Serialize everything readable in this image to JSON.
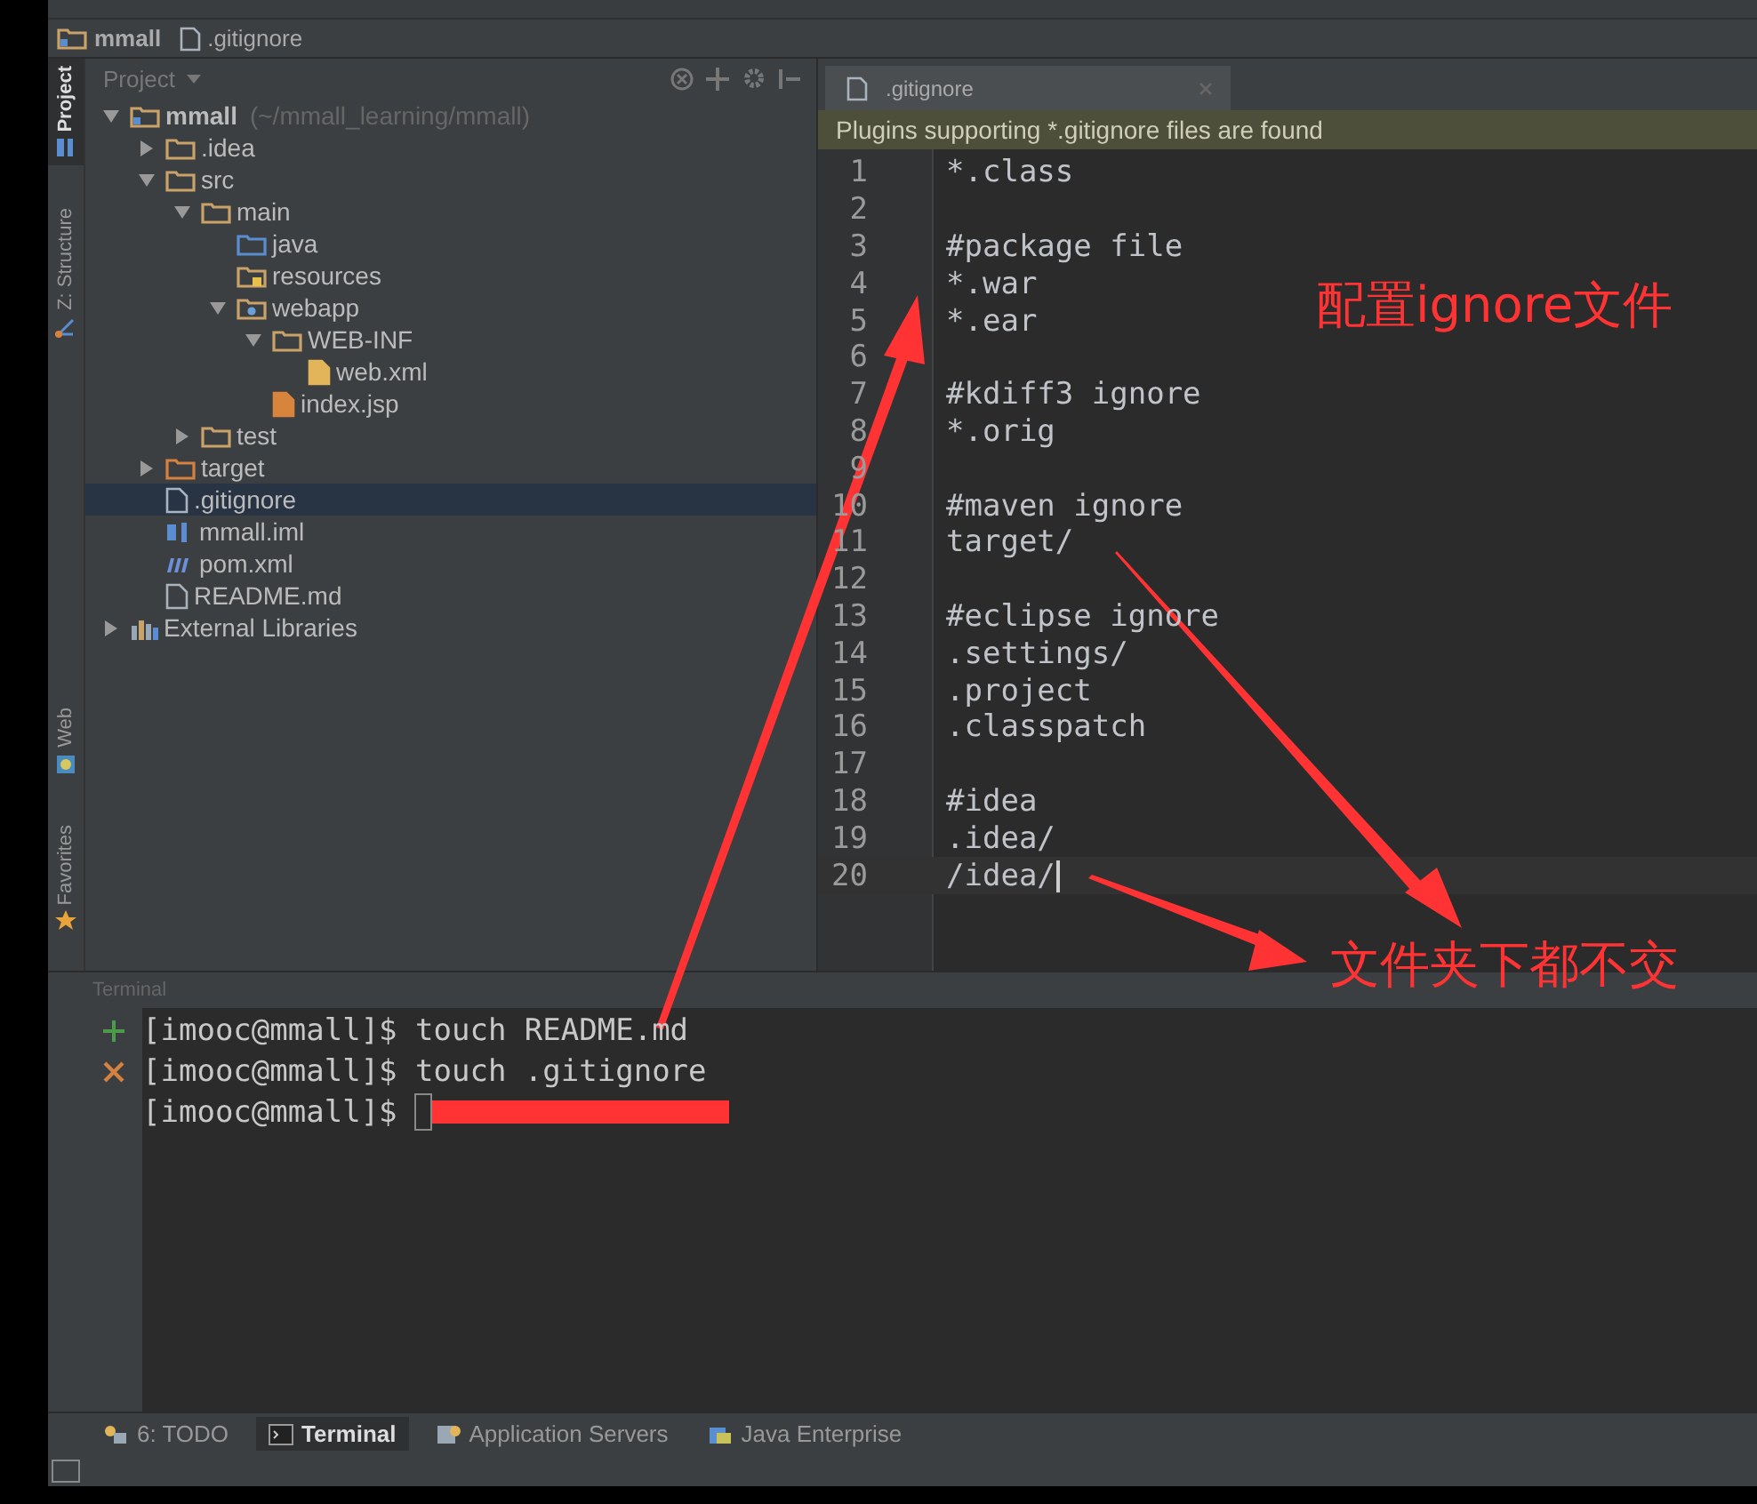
{
  "breadcrumb": [
    {
      "label": "mmall",
      "kind": "module"
    },
    {
      "label": ".gitignore",
      "kind": "file"
    }
  ],
  "left_tool_tabs_top": [
    {
      "label": "Project",
      "kind": "project",
      "selected": true
    },
    {
      "label": "Z: Structure",
      "kind": "structure",
      "selected": false
    }
  ],
  "left_tool_tabs_bottom": [
    {
      "label": "Web",
      "kind": "web",
      "selected": false
    },
    {
      "label": "Favorites",
      "kind": "favorites",
      "selected": false
    }
  ],
  "project_panel": {
    "title": "Project",
    "tree": [
      {
        "label": "mmall",
        "hint": "(~/mmall_learning/mmall)",
        "kind": "module",
        "expanded": true,
        "selected": false,
        "children": [
          {
            "label": ".idea",
            "kind": "folder",
            "expanded": false,
            "selected": false
          },
          {
            "label": "src",
            "kind": "folder",
            "expanded": true,
            "selected": false,
            "children": [
              {
                "label": "main",
                "kind": "folder",
                "expanded": true,
                "selected": false,
                "children": [
                  {
                    "label": "java",
                    "kind": "source-folder",
                    "selected": false
                  },
                  {
                    "label": "resources",
                    "kind": "resource-folder",
                    "selected": false
                  },
                  {
                    "label": "webapp",
                    "kind": "web-folder",
                    "expanded": true,
                    "selected": false,
                    "children": [
                      {
                        "label": "WEB-INF",
                        "kind": "folder",
                        "expanded": true,
                        "selected": false,
                        "children": [
                          {
                            "label": "web.xml",
                            "kind": "xml-file",
                            "selected": false
                          }
                        ]
                      },
                      {
                        "label": "index.jsp",
                        "kind": "jsp-file",
                        "selected": false
                      }
                    ]
                  }
                ]
              },
              {
                "label": "test",
                "kind": "folder",
                "expanded": false,
                "selected": false
              }
            ]
          },
          {
            "label": "target",
            "kind": "excluded-folder",
            "expanded": false,
            "selected": false
          },
          {
            "label": ".gitignore",
            "kind": "text-file",
            "selected": true
          },
          {
            "label": "mmall.iml",
            "kind": "iml-file",
            "selected": false
          },
          {
            "label": "pom.xml",
            "kind": "maven-file",
            "selected": false
          },
          {
            "label": "README.md",
            "kind": "text-file",
            "selected": false
          }
        ]
      },
      {
        "label": "External Libraries",
        "kind": "libraries",
        "expanded": false,
        "selected": false
      }
    ]
  },
  "editor": {
    "tabs": [
      {
        "label": ".gitignore",
        "selected": true
      }
    ],
    "notice": "Plugins supporting *.gitignore files are found",
    "lines": [
      {
        "number": "1",
        "text": "*.class",
        "current": false
      },
      {
        "number": "2",
        "current": false
      },
      {
        "number": "3",
        "text": "#package file",
        "current": false
      },
      {
        "number": "4",
        "text": "*.war",
        "current": false
      },
      {
        "number": "5",
        "text": "*.ear",
        "current": false
      },
      {
        "number": "6",
        "current": false
      },
      {
        "number": "7",
        "text": "#kdiff3 ignore",
        "current": false
      },
      {
        "number": "8",
        "text": "*.orig",
        "current": false
      },
      {
        "number": "9",
        "current": false
      },
      {
        "number": "10",
        "text": "#maven ignore",
        "current": false
      },
      {
        "number": "11",
        "text": "target/",
        "current": false
      },
      {
        "number": "12",
        "current": false
      },
      {
        "number": "13",
        "text": "#eclipse ignore",
        "current": false
      },
      {
        "number": "14",
        "text": ".settings/",
        "current": false
      },
      {
        "number": "15",
        "text": ".project",
        "current": false
      },
      {
        "number": "16",
        "text": ".classpatch",
        "current": false
      },
      {
        "number": "17",
        "current": false
      },
      {
        "number": "18",
        "text": "#idea",
        "current": false
      },
      {
        "number": "19",
        "text": ".idea/",
        "current": false
      },
      {
        "number": "20",
        "text": "/idea/",
        "current": true
      }
    ]
  },
  "terminal": {
    "title": "Terminal",
    "lines": [
      {
        "prompt": "[imooc@mmall]$",
        "command": "touch README.md",
        "cursor": false
      },
      {
        "prompt": "[imooc@mmall]$",
        "command": "touch .gitignore",
        "cursor": false
      },
      {
        "prompt": "[imooc@mmall]$",
        "cursor": true
      }
    ]
  },
  "bottom_tabs": [
    {
      "label": "6: TODO",
      "kind": "todo",
      "selected": false
    },
    {
      "label": "Terminal",
      "kind": "terminal",
      "selected": true
    },
    {
      "label": "Application Servers",
      "kind": "servers",
      "selected": false
    },
    {
      "label": "Java Enterprise",
      "kind": "enterprise",
      "selected": false
    }
  ],
  "annotations": [
    {
      "text": "配置ignore文件",
      "kind": "title"
    },
    {
      "text": "文件夹下都不交",
      "kind": "note"
    }
  ]
}
